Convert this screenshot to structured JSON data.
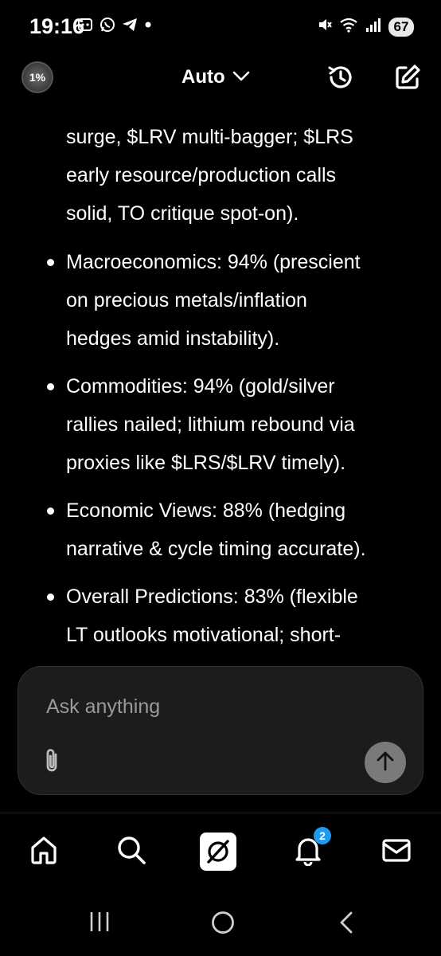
{
  "status_bar": {
    "time": "19:16",
    "left_icons": [
      "screenshot-icon",
      "whatsapp-icon",
      "telegram-icon",
      "dot-icon"
    ],
    "right_icons": [
      "mute-icon",
      "wifi-icon",
      "signal-icon"
    ],
    "battery": "67"
  },
  "header": {
    "avatar_text": "1%",
    "model_label": "Auto",
    "icons": [
      "history-icon",
      "compose-icon"
    ]
  },
  "content": {
    "intro_lines": [
      "surge, $LRV multi-bagger; $LRS",
      "early resource/production calls",
      "solid, TO critique spot-on)."
    ],
    "bullets": [
      {
        "lines": [
          "Macroeconomics: 94% (prescient",
          "on precious metals/inflation",
          "hedges amid instability)."
        ]
      },
      {
        "lines": [
          "Commodities: 94% (gold/silver",
          "rallies nailed; lithium rebound via",
          "proxies like $LRS/$LRV timely)."
        ]
      },
      {
        "lines": [
          "Economic Views: 88% (hedging",
          "narrative & cycle timing accurate)."
        ]
      },
      {
        "lines": [
          "Overall Predictions: 83% (flexible",
          "LT outlooks motivational; short-"
        ]
      }
    ]
  },
  "composer": {
    "placeholder": "Ask anything"
  },
  "bottom_nav": {
    "items": [
      "home-icon",
      "search-icon",
      "grok-icon",
      "notifications-icon",
      "messages-icon"
    ],
    "notification_count": "2"
  },
  "system_nav": [
    "recents-icon",
    "home-circle-icon",
    "back-icon"
  ]
}
